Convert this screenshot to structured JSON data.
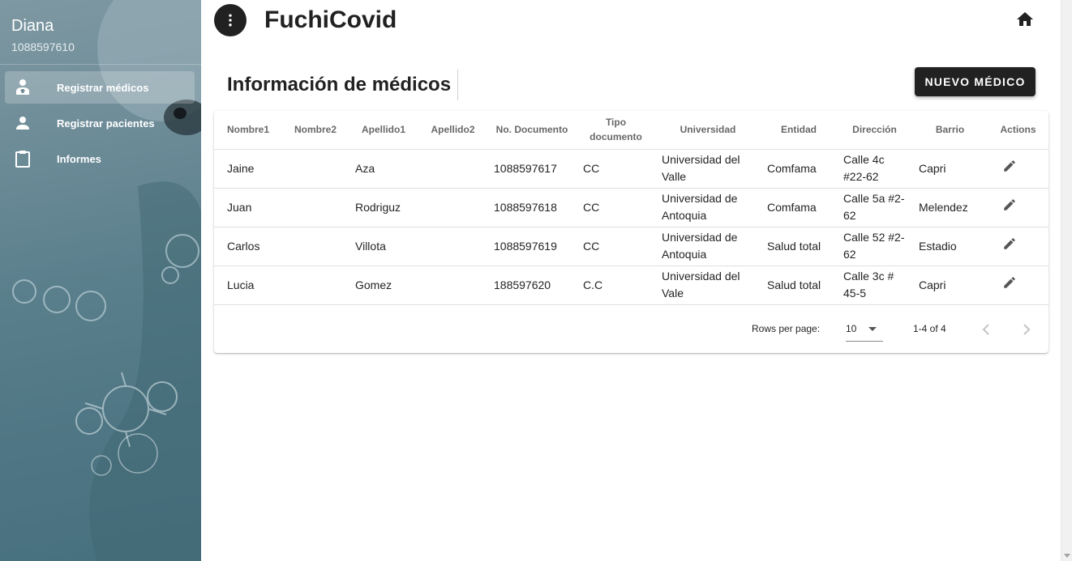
{
  "user": {
    "name": "Diana",
    "id": "1088597610"
  },
  "nav": [
    {
      "label": "Registrar médicos",
      "icon": "doctor-icon",
      "active": true
    },
    {
      "label": "Registrar pacientes",
      "icon": "person-icon",
      "active": false
    },
    {
      "label": "Informes",
      "icon": "clipboard-icon",
      "active": false
    }
  ],
  "header": {
    "title": "FuchiCovid",
    "menu_icon": "more-vert-icon",
    "home_icon": "home-icon"
  },
  "page": {
    "title": "Información de médicos",
    "new_button": "NUEVO MÉDICO"
  },
  "table": {
    "columns": [
      "Nombre1",
      "Nombre2",
      "Apellido1",
      "Apellido2",
      "No. Documento",
      "Tipo documento",
      "Universidad",
      "Entidad",
      "Dirección",
      "Barrio",
      "Actions"
    ],
    "rows": [
      [
        "Jaine",
        "",
        "Aza",
        "",
        "1088597617",
        "CC",
        "Universidad del Valle",
        "Comfama",
        "Calle 4c #22-62",
        "Capri"
      ],
      [
        "Juan",
        "",
        "Rodriguz",
        "",
        "1088597618",
        "CC",
        "Universidad de Antoquia",
        "Comfama",
        "Calle 5a #2-62",
        "Melendez"
      ],
      [
        "Carlos",
        "",
        "Villota",
        "",
        "1088597619",
        "CC",
        "Universidad de Antoquia",
        "Salud total",
        "Calle 52 #2-62",
        "Estadio"
      ],
      [
        "Lucia",
        "",
        "Gomez",
        "",
        "188597620",
        "C.C",
        "Universidad del Vale",
        "Salud total",
        "Calle 3c # 45-5",
        "Capri"
      ]
    ],
    "row_action_icon": "edit-icon"
  },
  "pagination": {
    "rows_per_page_label": "Rows per page:",
    "rows_per_page": "10",
    "range": "1-4 of 4"
  },
  "colors": {
    "accent": "#212121",
    "sidebar": "#5a7f8c"
  }
}
